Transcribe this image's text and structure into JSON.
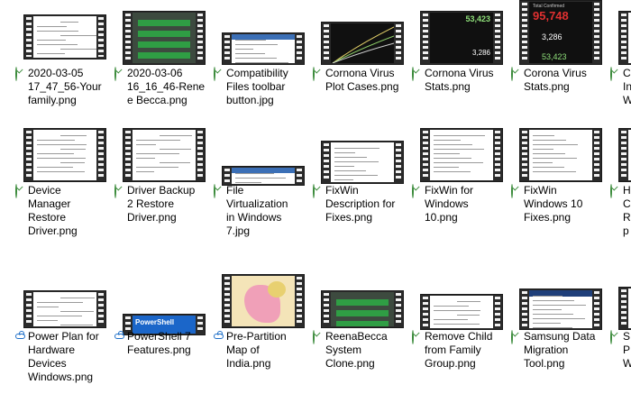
{
  "files": [
    {
      "name": "2020-03-05 17_47_56-Your family.png",
      "lines": [
        "2020-03-05",
        "17_47_56-Your",
        "family.png"
      ],
      "status": "synced",
      "thumb": "doc-window"
    },
    {
      "name": "2020-03-06 16_16_46-Rene Becca.png",
      "lines": [
        "2020-03-06",
        "16_16_46-Rene",
        "e Becca.png"
      ],
      "status": "synced",
      "thumb": "green-menu"
    },
    {
      "name": "Compatibility Files toolbar button.jpg",
      "lines": [
        "Compatibility",
        "Files toolbar",
        "button.jpg"
      ],
      "status": "synced",
      "thumb": "explorer-toolbar"
    },
    {
      "name": "Cornona Virus Plot Cases.png",
      "lines": [
        "Cornona Virus",
        "Plot Cases.png"
      ],
      "status": "synced",
      "thumb": "dark-plot"
    },
    {
      "name": "Cornona Virus Stats.png",
      "lines": [
        "Cornona Virus",
        "Stats.png"
      ],
      "status": "synced",
      "thumb": "dark-stats"
    },
    {
      "name": "Corona Virus Stats.png",
      "lines": [
        "Corona Virus",
        "Stats.png"
      ],
      "status": "synced",
      "thumb": "dark-counter"
    },
    {
      "name": "C... In... W...",
      "lines": [
        "C",
        "In",
        "W"
      ],
      "status": "synced",
      "thumb": "partial"
    },
    {
      "name": "Device Manager Restore Driver.png",
      "lines": [
        "Device",
        "Manager",
        "Restore",
        "Driver.png"
      ],
      "status": "synced",
      "thumb": "doc-window"
    },
    {
      "name": "Driver Backup 2 Restore Driver.png",
      "lines": [
        "Driver Backup",
        "2 Restore",
        "Driver.png"
      ],
      "status": "synced",
      "thumb": "doc-window"
    },
    {
      "name": "File Virtualization in Windows 7.jpg",
      "lines": [
        "File",
        "Virtualization",
        "in Windows",
        "7.jpg"
      ],
      "status": "synced",
      "thumb": "explorer-toolbar"
    },
    {
      "name": "FixWin Description for Fixes.png",
      "lines": [
        "FixWin",
        "Description for",
        "Fixes.png"
      ],
      "status": "synced",
      "thumb": "text-doc"
    },
    {
      "name": "FixWin for Windows 10.png",
      "lines": [
        "FixWin for",
        "Windows",
        "10.png"
      ],
      "status": "synced",
      "thumb": "text-list"
    },
    {
      "name": "FixWin Windows 10 Fixes.png",
      "lines": [
        "FixWin",
        "Windows 10",
        "Fixes.png"
      ],
      "status": "synced",
      "thumb": "text-list"
    },
    {
      "name": "H... C... R... p...",
      "lines": [
        "H",
        "C",
        "R",
        "p"
      ],
      "status": "synced",
      "thumb": "partial"
    },
    {
      "name": "Power Plan for Hardware Devices Windows.png",
      "lines": [
        "Power Plan for",
        "Hardware",
        "Devices",
        "Windows.png"
      ],
      "status": "cloud",
      "thumb": "doc-window"
    },
    {
      "name": "PowerShell 7 Features.png",
      "lines": [
        "PowerShell 7",
        "Features.png"
      ],
      "status": "cloud",
      "thumb": "powershell"
    },
    {
      "name": "Pre-Partition Map of India.png",
      "lines": [
        "Pre-Partition",
        "Map of",
        "India.png"
      ],
      "status": "cloud",
      "thumb": "map"
    },
    {
      "name": "ReenaBecca System Clone.png",
      "lines": [
        "ReenaBecca",
        "System",
        "Clone.png"
      ],
      "status": "synced",
      "thumb": "green-menu"
    },
    {
      "name": "Remove Child from Family Group.png",
      "lines": [
        "Remove Child",
        "from Family",
        "Group.png"
      ],
      "status": "synced",
      "thumb": "doc-window"
    },
    {
      "name": "Samsung Data Migration Tool.png",
      "lines": [
        "Samsung Data",
        "Migration",
        "Tool.png"
      ],
      "status": "synced",
      "thumb": "samsung"
    },
    {
      "name": "S... P... W...",
      "lines": [
        "S",
        "P",
        "W"
      ],
      "status": "synced",
      "thumb": "partial"
    }
  ],
  "thumb_text": {
    "stats_top": "53,423",
    "stats_mid": "3,286",
    "counter_label": "Total Confirmed",
    "counter_big": "95,748",
    "counter_mid": "3,286",
    "counter_bottom": "53,423",
    "powershell": "PowerShell"
  },
  "colors": {
    "check_green": "#3a8a3a",
    "cloud_blue": "#1e6fc8",
    "film_dark": "#2b2b2b"
  }
}
